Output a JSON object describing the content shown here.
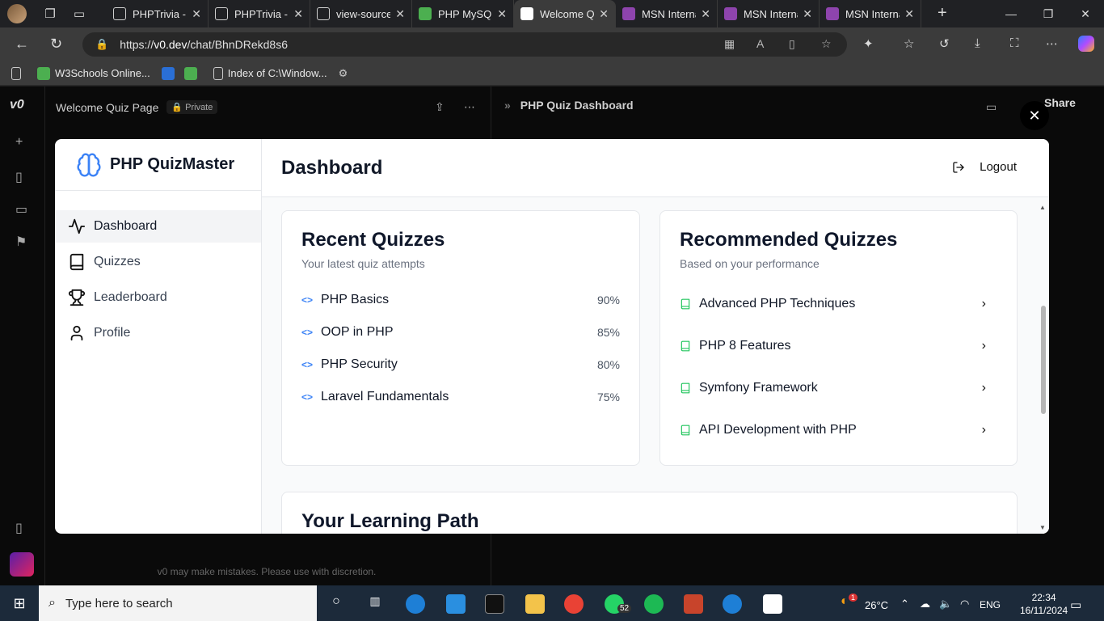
{
  "browser": {
    "tabs": [
      {
        "label": "PHPTrivia - D",
        "favicon_color": "#cfcfcf",
        "active": false
      },
      {
        "label": "PHPTrivia - D",
        "favicon_color": "#cfcfcf",
        "active": false
      },
      {
        "label": "view-source:",
        "favicon_color": "#cfcfcf",
        "active": false
      },
      {
        "label": "PHP MySQL",
        "favicon_color": "#4caf50",
        "active": false
      },
      {
        "label": "Welcome Qu",
        "favicon_color": "#ffffff",
        "active": true
      },
      {
        "label": "MSN Interna",
        "favicon_color": "#8e44ad",
        "active": false
      },
      {
        "label": "MSN Interna",
        "favicon_color": "#8e44ad",
        "active": false
      },
      {
        "label": "MSN Interna",
        "favicon_color": "#8e44ad",
        "active": false
      }
    ],
    "url_prefix": "https://",
    "url_host": "v0.dev",
    "url_path": "/chat/BhnDRekd8s6",
    "bookmarks": [
      {
        "label": "",
        "icon": "page-icon"
      },
      {
        "label": "W3Schools Online...",
        "icon": "w3schools-icon"
      },
      {
        "label": "",
        "icon": "bookmark-icon"
      },
      {
        "label": "",
        "icon": "w3-icon"
      },
      {
        "label": "Index of C:\\Window...",
        "icon": "page-icon"
      },
      {
        "label": "",
        "icon": "gear-icon"
      }
    ]
  },
  "v0": {
    "chat_title": "Welcome Quiz Page",
    "privacy_badge": "Private",
    "preview_title": "PHP Quiz Dashboard",
    "share_label": "Share",
    "disclaimer": "v0 may make mistakes. Please use with discretion."
  },
  "modal": {
    "brand": "PHP QuizMaster",
    "nav": [
      {
        "label": "Dashboard",
        "icon": "activity-icon",
        "active": true
      },
      {
        "label": "Quizzes",
        "icon": "book-icon",
        "active": false
      },
      {
        "label": "Leaderboard",
        "icon": "trophy-icon",
        "active": false
      },
      {
        "label": "Profile",
        "icon": "user-icon",
        "active": false
      }
    ],
    "page_title": "Dashboard",
    "logout_label": "Logout",
    "recent": {
      "title": "Recent Quizzes",
      "subtitle": "Your latest quiz attempts",
      "items": [
        {
          "name": "PHP Basics",
          "score": "90%"
        },
        {
          "name": "OOP in PHP",
          "score": "85%"
        },
        {
          "name": "PHP Security",
          "score": "80%"
        },
        {
          "name": "Laravel Fundamentals",
          "score": "75%"
        }
      ]
    },
    "recommended": {
      "title": "Recommended Quizzes",
      "subtitle": "Based on your performance",
      "items": [
        {
          "name": "Advanced PHP Techniques"
        },
        {
          "name": "PHP 8 Features"
        },
        {
          "name": "Symfony Framework"
        },
        {
          "name": "API Development with PHP"
        }
      ]
    },
    "learning_path_title": "Your Learning Path"
  },
  "taskbar": {
    "search_placeholder": "Type here to search",
    "weather": "26°C",
    "language": "ENG",
    "time": "22:34",
    "date": "16/11/2024",
    "whatsapp_badge": "52",
    "weather_badge": "1"
  },
  "colors": {
    "accent": "#3b82f6",
    "recommend_icon": "#22c55e"
  }
}
